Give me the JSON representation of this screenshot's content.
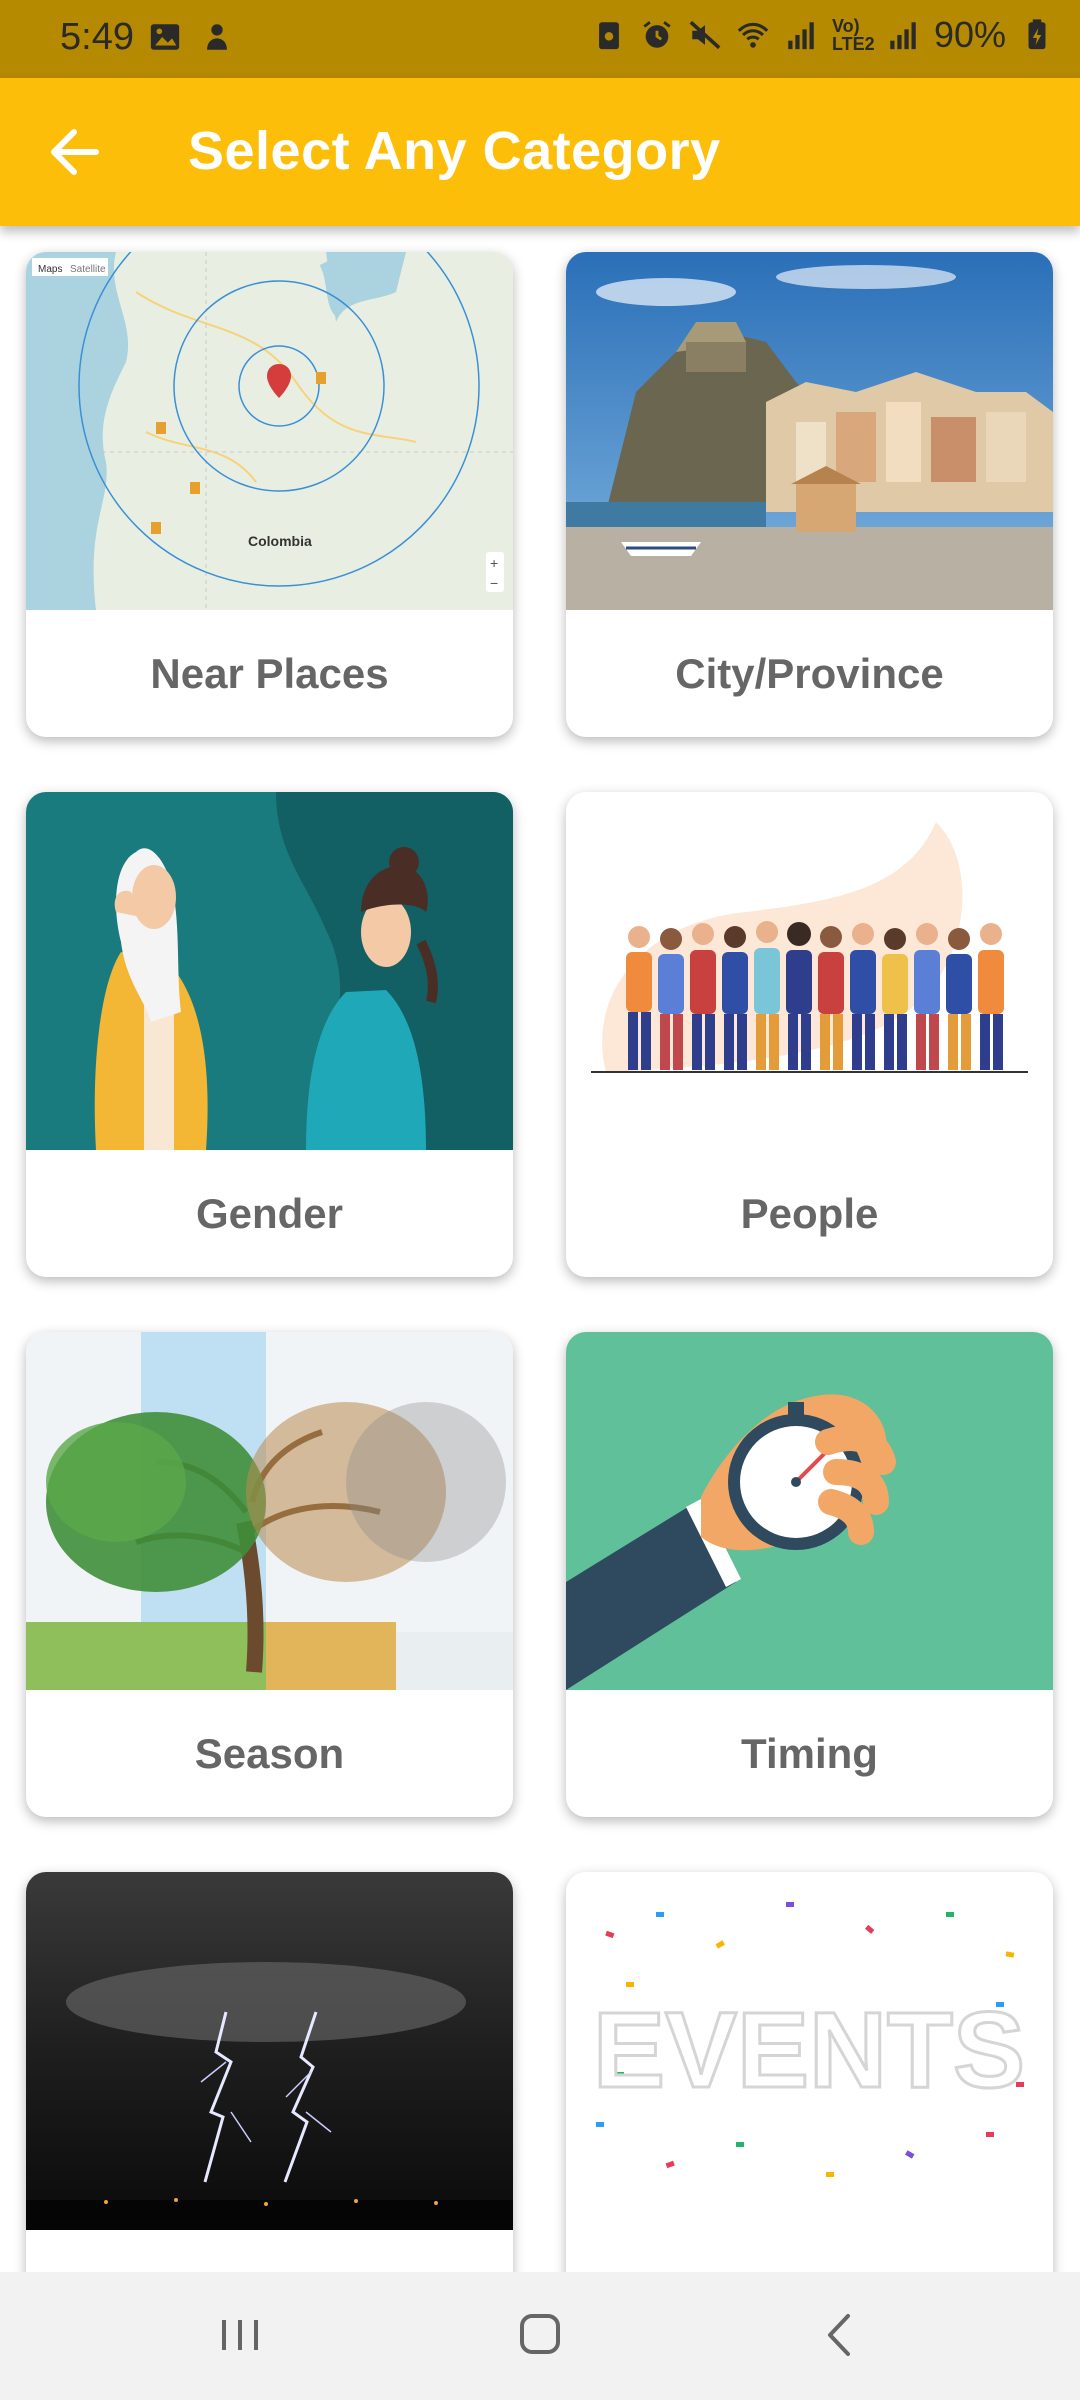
{
  "status_bar": {
    "time": "5:49",
    "battery": "90%",
    "network_label": "Vo) LTE2",
    "icons": [
      "image-icon",
      "notification-icon",
      "screenshot-icon",
      "alarm-icon",
      "mute-icon",
      "wifi-icon",
      "signal-icon",
      "battery-icon"
    ]
  },
  "app_bar": {
    "title": "Select Any Category",
    "back_icon": "arrow-left-icon",
    "background": "#fdbe0a"
  },
  "categories": [
    {
      "label": "Near Places",
      "image": "map-colombia",
      "map_text": "Colombia",
      "map_tabs": [
        "Maps",
        "Satellite"
      ]
    },
    {
      "label": "City/Province",
      "image": "coastal-town"
    },
    {
      "label": "Gender",
      "image": "two-women-illustration"
    },
    {
      "label": "People",
      "image": "crowd-illustration"
    },
    {
      "label": "Season",
      "image": "tree-seasons"
    },
    {
      "label": "Timing",
      "image": "stopwatch-hand"
    },
    {
      "label": "",
      "image": "lightning-storm"
    },
    {
      "label": "",
      "image": "events-confetti",
      "image_text": "EVENTS"
    }
  ],
  "nav_bar": {
    "buttons": [
      "recent-apps-icon",
      "home-icon",
      "back-icon"
    ]
  }
}
